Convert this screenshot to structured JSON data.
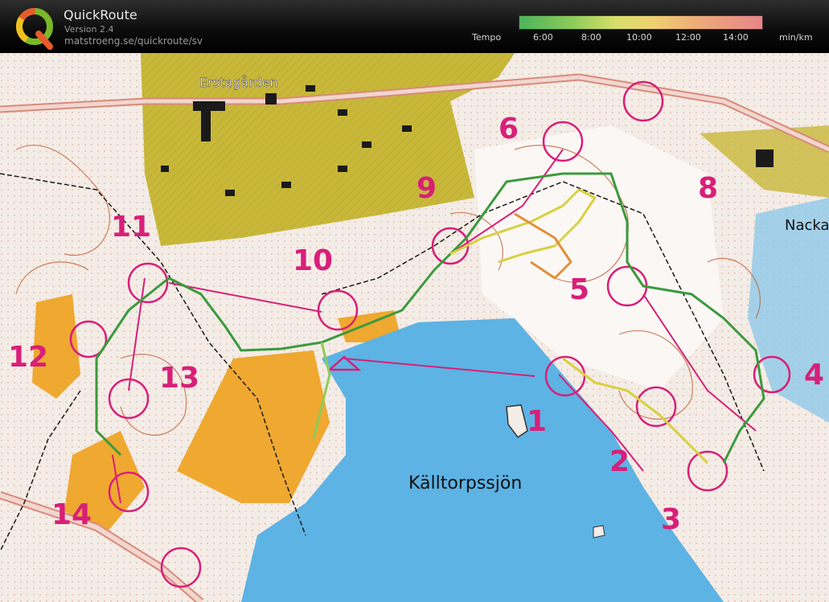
{
  "app": {
    "name": "QuickRoute",
    "version": "Version 2.4",
    "url": "matstroeng.se/quickroute/sv"
  },
  "tempo": {
    "label": "Tempo",
    "ticks": [
      "6:00",
      "8:00",
      "10:00",
      "12:00",
      "14:00"
    ],
    "unit": "min/km",
    "colors": [
      "#4cb45a",
      "#8ecb5a",
      "#d8e06a",
      "#f0d070",
      "#eeae78",
      "#e8848a"
    ]
  },
  "map": {
    "place_names": {
      "estate": "Erstagården",
      "lake": "Källtorpssjön",
      "area": "Nacka"
    },
    "controls": [
      "1",
      "2",
      "3",
      "4",
      "5",
      "6",
      "8",
      "9",
      "10",
      "11",
      "12",
      "13",
      "14"
    ],
    "colors": {
      "open_land": "#f3efe9",
      "forest": "#ffffff",
      "lake": "#5db3e4",
      "urban": "#c9b83a",
      "field": "#efa830",
      "course": "#d81f79",
      "contour": "#c0623a",
      "route_green": "#3a9a3e",
      "route_yellow": "#d8d040",
      "route_orange": "#e0903a"
    }
  }
}
